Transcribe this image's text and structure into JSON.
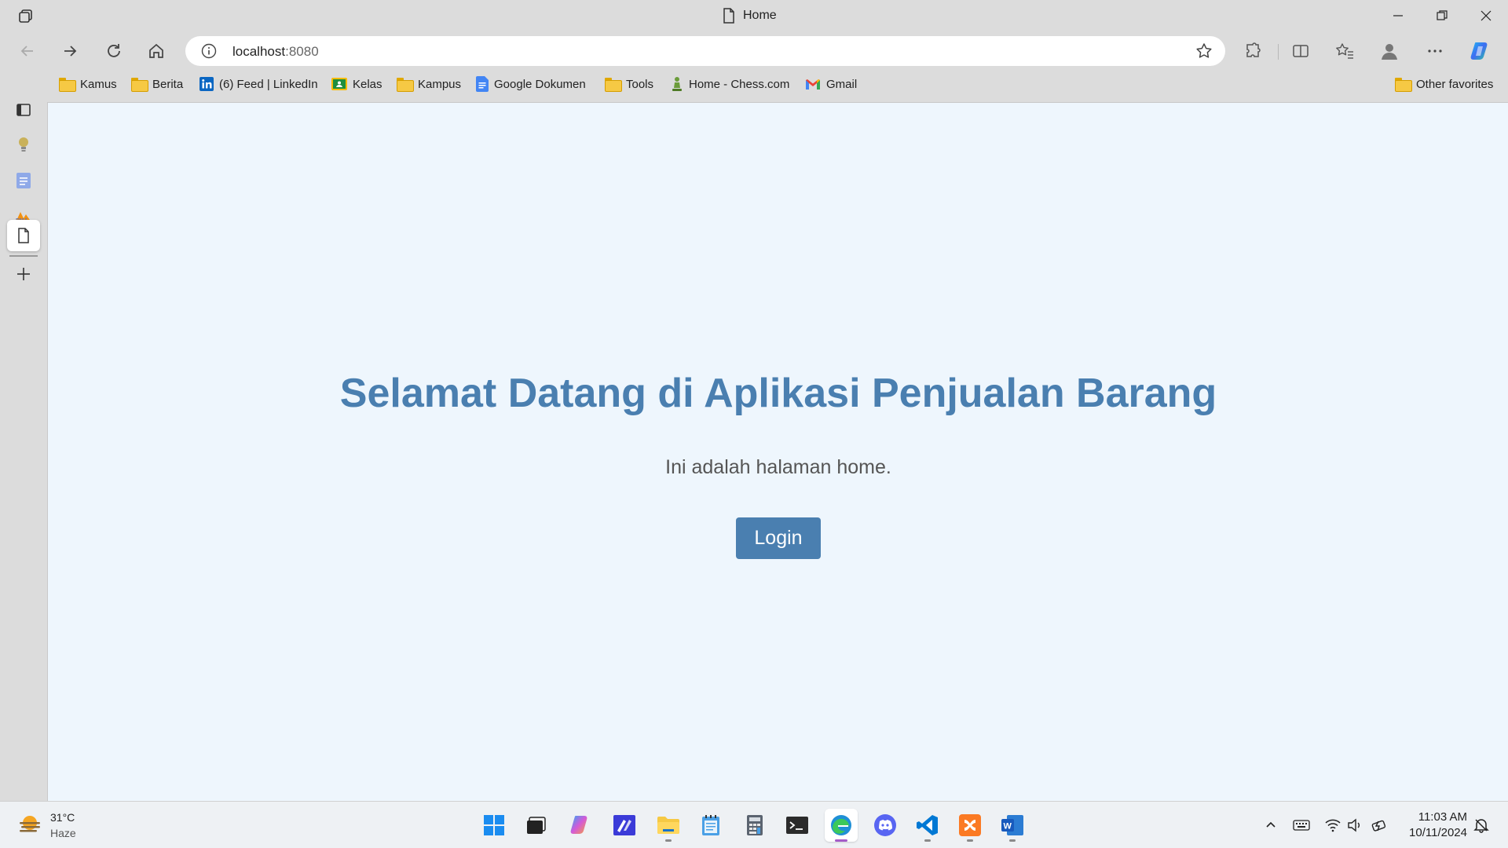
{
  "browser": {
    "tab_title": "Home",
    "address": {
      "host": "localhost",
      "port": ":8080"
    }
  },
  "bookmarks": [
    {
      "label": "Kamus",
      "icon": "folder-icon"
    },
    {
      "label": "Berita",
      "icon": "folder-icon"
    },
    {
      "label": "(6) Feed | LinkedIn",
      "icon": "linkedin-icon"
    },
    {
      "label": "Kelas",
      "icon": "classroom-icon"
    },
    {
      "label": "Kampus",
      "icon": "folder-icon"
    },
    {
      "label": "Google Dokumen",
      "icon": "google-docs-icon"
    },
    {
      "label": "Tools",
      "icon": "folder-icon"
    },
    {
      "label": "Home - Chess.com",
      "icon": "chess-icon"
    },
    {
      "label": "Gmail",
      "icon": "gmail-icon"
    }
  ],
  "other_favorites": "Other favorites",
  "page": {
    "title": "Selamat Datang di Aplikasi Penjualan Barang",
    "subtitle": "Ini adalah halaman home.",
    "login_button": "Login"
  },
  "taskbar": {
    "weather": {
      "temp": "31°C",
      "condition": "Haze"
    },
    "clock": {
      "time": "11:03 AM",
      "date": "10/11/2024"
    }
  },
  "colors": {
    "page_bg": "#eef6fd",
    "accent": "#4a7fb0",
    "subtitle": "#555555"
  }
}
